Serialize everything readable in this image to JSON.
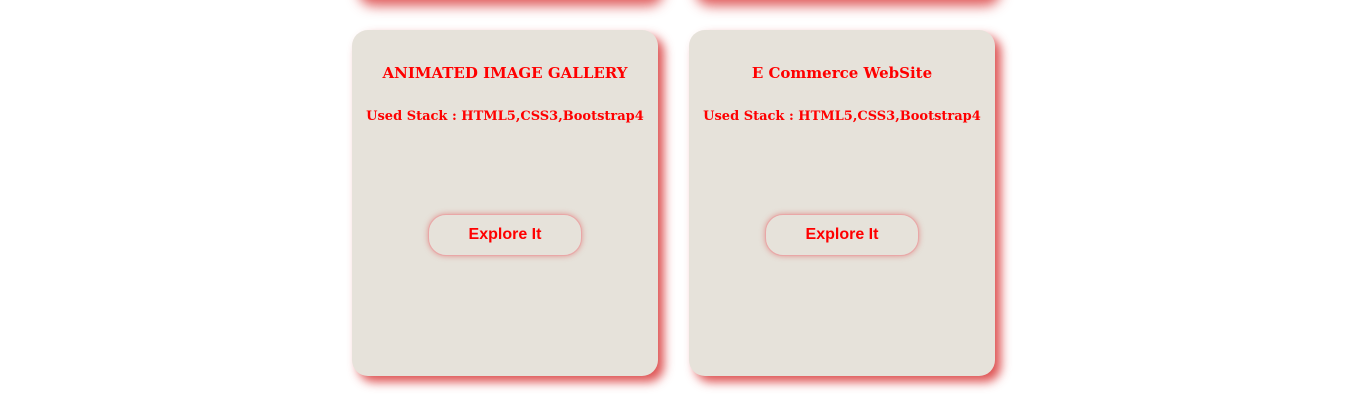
{
  "cards": [
    {
      "title": "ANIMATED IMAGE GALLERY",
      "stack": "Used Stack : HTML5,CSS3,Bootstrap4",
      "button_label": "Explore It"
    },
    {
      "title": "E Commerce WebSite",
      "stack": "Used Stack : HTML5,CSS3,Bootstrap4",
      "button_label": "Explore It"
    }
  ],
  "colors": {
    "card_background": "#e6e2da",
    "text_accent": "#ff0000",
    "shadow": "#d62828",
    "page_background": "#ffffff"
  }
}
